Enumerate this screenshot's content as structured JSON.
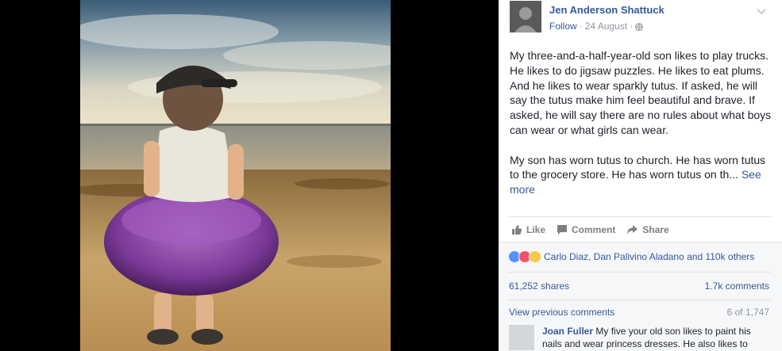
{
  "post": {
    "author": "Jen Anderson Shattuck",
    "follow": "Follow",
    "date": "24 August",
    "separator": "·",
    "text_p1": "My three-and-a-half-year-old son likes to play trucks. He likes to do jigsaw puzzles. He likes to eat plums. And he likes to wear sparkly tutus. If asked, he will say the tutus make him feel beautiful and brave. If asked, he will say there are no rules about what boys can wear or what girls can wear.",
    "text_p2": "My son has worn tutus to church. He has worn tutus to the grocery store. He has worn tutus on th...",
    "see_more": "See more"
  },
  "actions": {
    "like": "Like",
    "comment": "Comment",
    "share": "Share"
  },
  "feedback": {
    "reactions_text": "Carlo Diaz, Dan Palivino Aladano and 110k others",
    "shares": "61,252 shares",
    "comments": "1.7k comments",
    "view_previous": "View previous comments",
    "page_count": "6 of 1,747"
  },
  "comment": {
    "author": "Joan Fuller",
    "text": "My five your old son likes to paint his nails and wear princess dresses. He also likes to"
  },
  "colors": {
    "link": "#365899",
    "like_blue": "#5890ff",
    "love_red": "#f25268",
    "sad_yellow": "#f7c84a"
  }
}
